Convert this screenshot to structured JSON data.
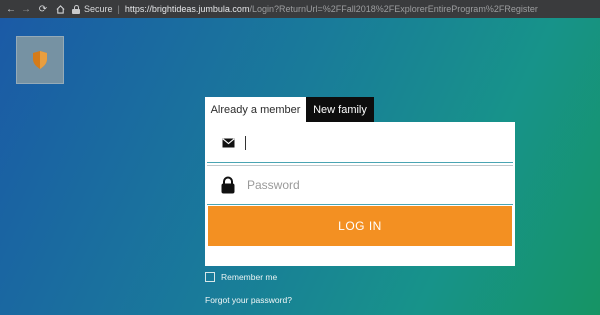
{
  "browser": {
    "back_icon": "arrow-left-icon",
    "forward_icon": "arrow-right-icon",
    "reload_icon": "reload-icon",
    "home_icon": "home-icon",
    "secure_label": "Secure",
    "separator": "|",
    "url_host": "https://brightideas.jumbula.com",
    "url_path": "/Login?ReturnUrl=%2FFall2018%2FExplorerEntireProgram%2FRegister"
  },
  "logo": {
    "icon": "shield-icon"
  },
  "tabs": [
    {
      "label": "Already a member",
      "active": true
    },
    {
      "label": "New family",
      "active": false
    }
  ],
  "form": {
    "email": {
      "icon": "envelope-icon",
      "value": "",
      "placeholder": ""
    },
    "password": {
      "icon": "padlock-icon",
      "value": "",
      "placeholder": "Password"
    },
    "login_label": "LOG IN",
    "remember_label": "Remember me",
    "remember_checked": false,
    "forgot_label": "Forgot your password?"
  },
  "colors": {
    "login_button": "#f39022",
    "field_border": "#4aa5b3",
    "tab_inactive": "#0d0d0d"
  }
}
